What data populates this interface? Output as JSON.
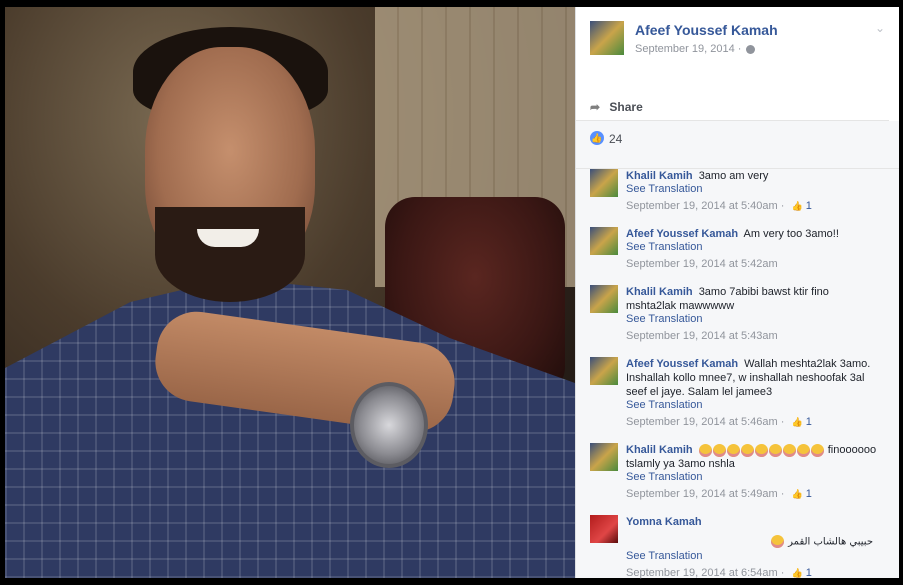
{
  "post": {
    "author": "Afeef Youssef Kamah",
    "date": "September 19, 2014 ·",
    "share_label": "Share",
    "like_count": "24"
  },
  "comments": [
    {
      "author": "Khalil Kamih",
      "text": "3amo am very",
      "translate": "See Translation",
      "time": "September 19, 2014 at 5:40am ·",
      "likes": "1"
    },
    {
      "author": "Afeef Youssef Kamah",
      "text": "Am very too 3amo!!",
      "translate": "See Translation",
      "time": "September 19, 2014 at 5:42am",
      "likes": ""
    },
    {
      "author": "Khalil Kamih",
      "text": "3amo 7abibi bawst ktir fino mshta2lak mawwwww",
      "translate": "See Translation",
      "time": "September 19, 2014 at 5:43am",
      "likes": ""
    },
    {
      "author": "Afeef Youssef Kamah",
      "text": "Wallah meshta2lak 3amo. Inshallah kollo mnee7, w inshallah neshoofak 3al seef el jaye. Salam lel jamee3",
      "translate": "See Translation",
      "time": "September 19, 2014 at 5:46am ·",
      "likes": "1"
    },
    {
      "author": "Khalil Kamih",
      "text": "finoooooo tslamly ya 3amo nshla",
      "translate": "See Translation",
      "time": "September 19, 2014 at 5:49am ·",
      "likes": "1"
    },
    {
      "author": "Yomna Kamah",
      "text": "حبيبي هالشاب القمر",
      "translate": "See Translation",
      "time": "September 19, 2014 at 6:54am ·",
      "likes": "1"
    }
  ],
  "icons": {
    "globe": "globe-icon",
    "share": "share-icon",
    "like": "like-icon",
    "chevron": "chevron-down-icon"
  },
  "colors": {
    "link": "#365899",
    "meta": "#90949c",
    "like_blue": "#5890ff",
    "panel_bg": "#f6f7f9"
  }
}
